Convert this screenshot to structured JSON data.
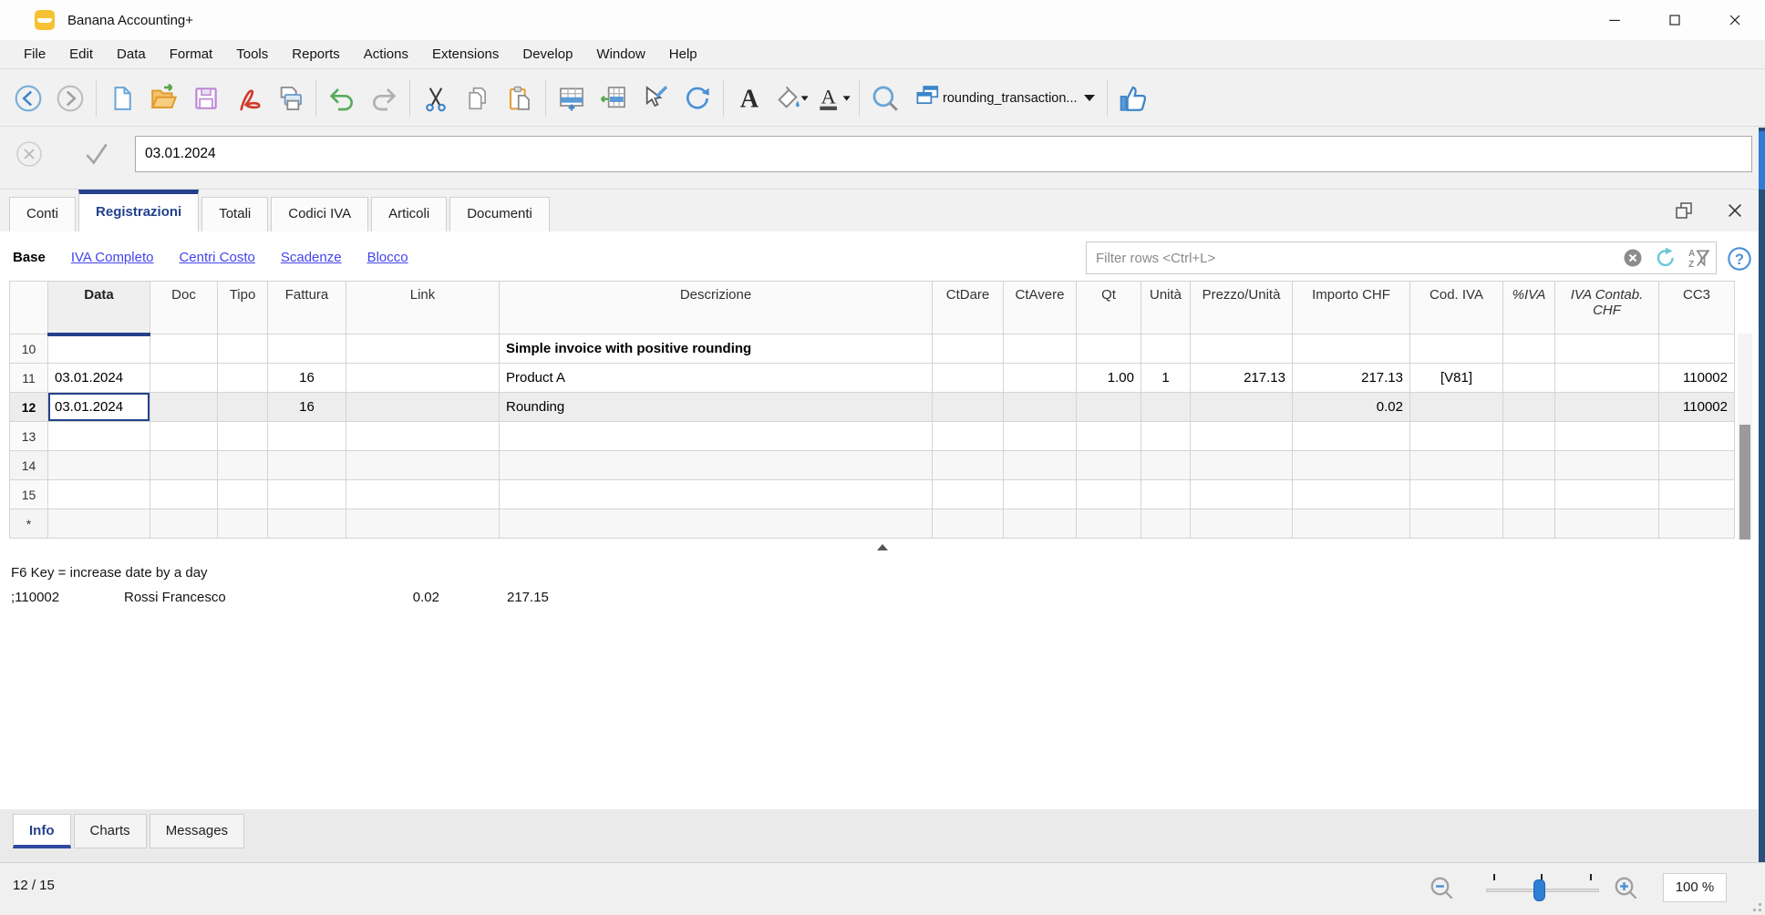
{
  "window": {
    "title": "Banana Accounting+"
  },
  "menu": {
    "items": [
      "File",
      "Edit",
      "Data",
      "Format",
      "Tools",
      "Reports",
      "Actions",
      "Extensions",
      "Develop",
      "Window",
      "Help"
    ]
  },
  "toolbar": {
    "buttons": [
      "back",
      "forward",
      "|",
      "new-file",
      "open-file",
      "save",
      "pdf-export",
      "print",
      "|",
      "undo",
      "redo",
      "|",
      "cut",
      "copy",
      "paste",
      "|",
      "add-row",
      "insert-row",
      "edit-cell",
      "recalculate",
      "|",
      "font-style",
      "fill-color",
      "font-color",
      "|",
      "search",
      "document-selector",
      "|",
      "like"
    ],
    "document_selector": "rounding_transaction..."
  },
  "edit_bar": {
    "value": "03.01.2024"
  },
  "table_tabs": {
    "items": [
      {
        "label": "Conti",
        "active": false
      },
      {
        "label": "Registrazioni",
        "active": true
      },
      {
        "label": "Totali",
        "active": false
      },
      {
        "label": "Codici IVA",
        "active": false
      },
      {
        "label": "Articoli",
        "active": false
      },
      {
        "label": "Documenti",
        "active": false
      }
    ]
  },
  "views": {
    "items": [
      {
        "label": "Base",
        "current": true
      },
      {
        "label": "IVA Completo",
        "current": false
      },
      {
        "label": "Centri Costo",
        "current": false
      },
      {
        "label": "Scadenze",
        "current": false
      },
      {
        "label": "Blocco",
        "current": false
      }
    ]
  },
  "filter": {
    "placeholder": "Filter rows <Ctrl+L>"
  },
  "table": {
    "columns": {
      "num": "",
      "data": "Data",
      "doc": "Doc",
      "tipo": "Tipo",
      "fattura": "Fattura",
      "link": "Link",
      "descrizione": "Descrizione",
      "ctdare": "CtDare",
      "ctavere": "CtAvere",
      "qt": "Qt",
      "unita": "Unità",
      "prezzo": "Prezzo/Unità",
      "importo": "Importo CHF",
      "cod_iva": "Cod. IVA",
      "perc_iva": "%IVA",
      "iva_contab": "IVA Contab. CHF",
      "cc3": "CC3"
    },
    "selected_column": "data",
    "selected_cell": {
      "row": "12",
      "column": "data"
    },
    "rows": [
      {
        "num": "10",
        "descrizione": "Simple invoice with positive rounding",
        "section": true
      },
      {
        "num": "11",
        "data": "03.01.2024",
        "fattura": "16",
        "descrizione": "Product A",
        "qt": "1.00",
        "unita": "1",
        "prezzo": "217.13",
        "importo": "217.13",
        "cod_iva": "[V81]",
        "cc3": "110002"
      },
      {
        "num": "12",
        "data": "03.01.2024",
        "fattura": "16",
        "descrizione": "Rounding",
        "importo": "0.02",
        "cc3": "110002"
      },
      {
        "num": "13"
      },
      {
        "num": "14"
      },
      {
        "num": "15"
      },
      {
        "num": "*"
      }
    ]
  },
  "info_panel": {
    "line1": "F6 Key = increase date by a day",
    "account": ";110002",
    "account_name": "Rossi Francesco",
    "amount": "0.02",
    "balance": "217.15"
  },
  "bottom_tabs": {
    "items": [
      {
        "label": "Info",
        "active": true
      },
      {
        "label": "Charts",
        "active": false
      },
      {
        "label": "Messages",
        "active": false
      }
    ]
  },
  "status_bar": {
    "position": "12 / 15",
    "zoom_level": "100 %"
  },
  "colors": {
    "accent_blue": "#24418c",
    "link_blue": "#4343ec",
    "toolbar_blue": "#3d85c8",
    "selection_border": "#24418c"
  }
}
